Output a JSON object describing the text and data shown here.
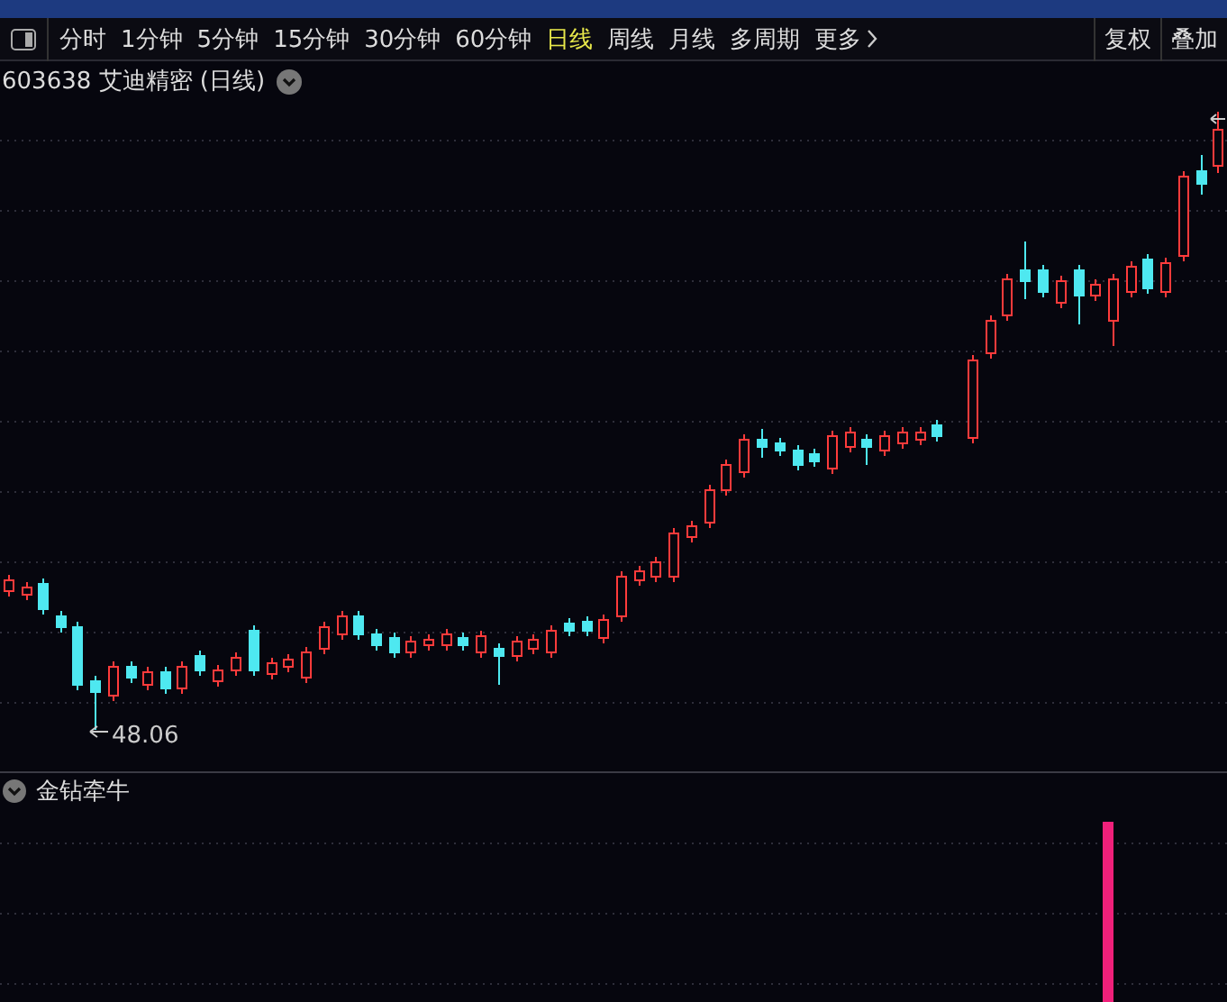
{
  "toolbar": {
    "periods": [
      {
        "label": "分时",
        "selected": false
      },
      {
        "label": "1分钟",
        "selected": false
      },
      {
        "label": "5分钟",
        "selected": false
      },
      {
        "label": "15分钟",
        "selected": false
      },
      {
        "label": "30分钟",
        "selected": false
      },
      {
        "label": "60分钟",
        "selected": false
      },
      {
        "label": "日线",
        "selected": true
      },
      {
        "label": "周线",
        "selected": false
      },
      {
        "label": "月线",
        "selected": false
      },
      {
        "label": "多周期",
        "selected": false
      }
    ],
    "more": "更多",
    "buttons": [
      "复权",
      "叠加"
    ]
  },
  "chart": {
    "title": "603638 艾迪精密 (日线)",
    "low_label": "48.06"
  },
  "indicator": {
    "name": "金钻牵牛"
  }
}
